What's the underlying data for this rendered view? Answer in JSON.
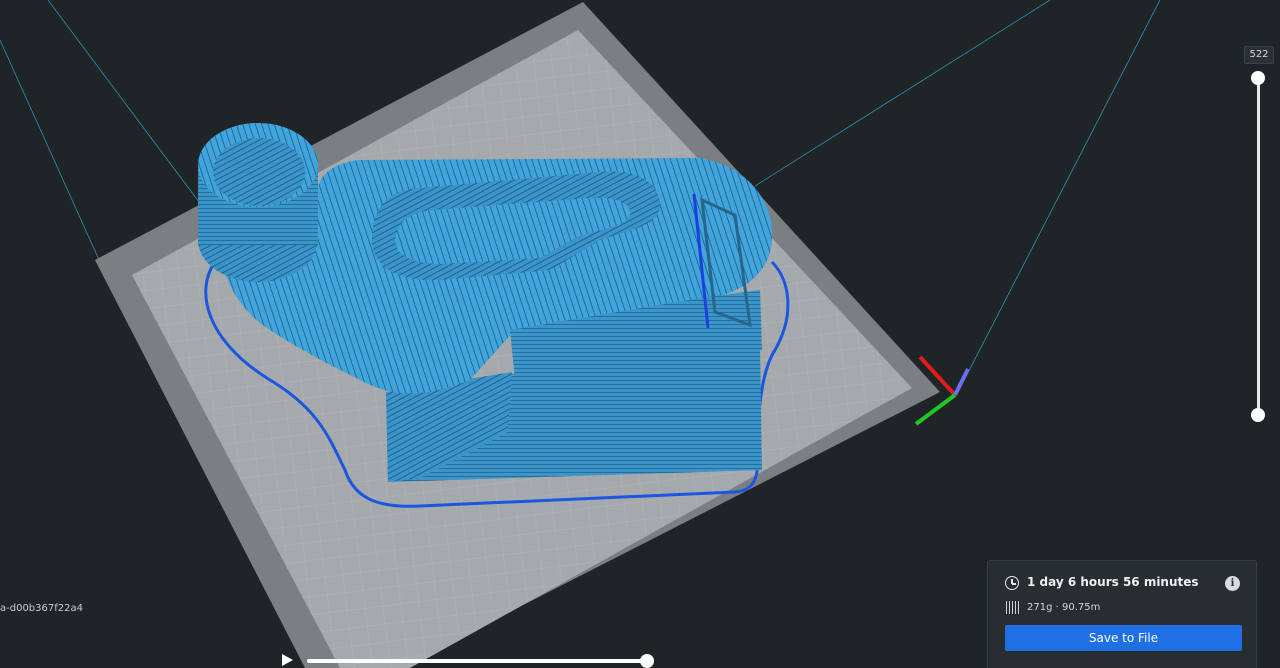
{
  "viewport": {
    "object_id": "a-d00b367f22a4"
  },
  "layer_slider": {
    "current_layer": "522"
  },
  "playback": {
    "play_icon": "play-icon"
  },
  "print_info": {
    "time_icon": "clock-icon",
    "print_time": "1 day 6 hours 56 minutes",
    "info_icon": "info-icon",
    "material_icon": "spool-icon",
    "material": "271g · 90.75m",
    "save_label": "Save to File"
  },
  "colors": {
    "background": "#1f2427",
    "build_plate": "#a5a8aa",
    "build_plate_border": "#7a7d80",
    "model_fill": "#3f9ad1",
    "travel_path": "#1b56e0",
    "accent_button": "#1f6fe5",
    "axis_x": "#e21b1b",
    "axis_y": "#22c624",
    "axis_z": "#6d6ef2"
  }
}
